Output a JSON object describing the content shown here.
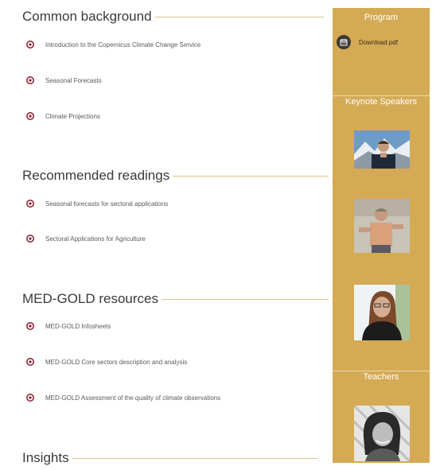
{
  "sections": [
    {
      "title": "Common background",
      "items": [
        "Introduction to the Copernicus Climate Change Service",
        "Seasonal Forecasts",
        "Climate Projections"
      ]
    },
    {
      "title": "Recommended readings",
      "items": [
        "Seasonal forecasts for sectoral applications",
        "Sectoral Applications for Agriculture"
      ]
    },
    {
      "title": "MED-GOLD resources",
      "items": [
        "MED-GOLD Infosheets",
        "MED-GOLD Core sectors description and analysis",
        "MED-GOLD Assessment of the quality of climate observations"
      ]
    },
    {
      "title": "Insights",
      "items": []
    }
  ],
  "sidebar": {
    "program_heading": "Program",
    "download_label": "Download pdf",
    "keynote_heading": "Keynote Speakers",
    "teachers_heading": "Teachers"
  },
  "colors": {
    "sidebar_bg": "#d4aa55",
    "bullet": "#8b1a2b",
    "title_rule": "#d9c48a"
  },
  "icons": {
    "bullet": "target-bullet-icon",
    "download": "calendar-icon"
  }
}
